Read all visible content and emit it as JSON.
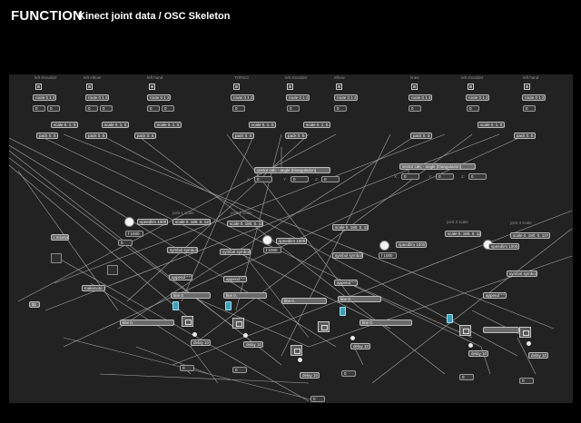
{
  "header": {
    "title": "FUNCTION",
    "subtitle": "Kinect joint data / OSC Skeleton"
  },
  "patch": {
    "joint_labels": [
      "left shoulder",
      "left elbow",
      "left hand",
      "TORSO",
      "left shoulder",
      "elbow",
      "knee",
      "left shoulder",
      "left hand"
    ],
    "route_labels": [
      "route 0 1 2 3",
      "route 0 1 2 3",
      "route 0 1 2 3",
      "route 0 1 2 3",
      "route 0 1 2 3",
      "route 0 1 2 3",
      "route 0 1 2 3",
      "route 0 1 2 3",
      "route 0 1 2 3"
    ],
    "scale_labels": [
      "scale 0. 1. 0. 1.",
      "scale 0. 1. 0. 1.",
      "scale 0. 1. 0. 1.",
      "scale 0. 1. 0. 1.",
      "scale 0. 1. 0. 1.",
      "scale 0. 1. 0. 1."
    ],
    "pack_labels": [
      "pack 0. 0. 0.",
      "pack 0. 0. 0.",
      "pack 0. 0. 0.",
      "pack 0. 0. 0.",
      "pack 0. 0. 0.",
      "pack 0. 0. 0.",
      "pack 0. 0. 0."
    ],
    "vector_left": "vector calc - angle (triangulation)",
    "vector_right": "vector calc - angle (triangulation)",
    "axis_x": "X:",
    "axis_y": "Y:",
    "axis_z": "Z:",
    "joint_scale_1": "joint 1 scale",
    "joint_scale_2": "joint 2 scale",
    "joint_scale_3": "joint 3 scale",
    "joint_scale_4": "joint 4 scale",
    "scale_obj_1": "scale 0. 180. 0. 127.",
    "scale_obj_2": "scale 0. 180. 0. 127.",
    "scale_obj_3": "scale 0. 180. 0. 127.",
    "scale_obj_4": "scale 0. 180. 0. 127.",
    "scale_obj_5": "scale 0. 180. 0. 127.",
    "scale_obj_6": "scale 0. 180. 0. 127.",
    "metro_1": "metro 1000",
    "metro_2": "metro 1000",
    "metro_3": "metro 1000",
    "speedlim_1": "speedlim 1000",
    "speedlim_2": "speedlim 1000",
    "speedlim_3": "speedlim 1000",
    "speedlim_4": "speedlim 1000",
    "symbol_1": "symbol symbol 52",
    "symbol_2": "symbol symbol 52",
    "symbol_3": "symbol symbol 52",
    "symbol_4": "symbol symbol 52",
    "append_1": "append \" \"",
    "append_2": "append \" \"",
    "append_3": "append \" \"",
    "append_4": "append \" \"",
    "receive": "r receive",
    "makenote": "makenote 100",
    "msg_1": "$1",
    "numbers": [
      "0",
      "0",
      "0",
      "0",
      "0",
      "0",
      "0",
      "0",
      "0",
      "0",
      "0",
      "0",
      "0",
      "0",
      "0",
      "0",
      "0",
      "0",
      "0"
    ],
    "delays": [
      "delay 10",
      "delay 10",
      "delay 10",
      "delay 10",
      "delay 10"
    ],
    "floats": [
      "f 1000",
      "f 1000",
      "f 1000"
    ],
    "lines": [
      "line 0.",
      "line 0.",
      "line 0.",
      "line 0.",
      "line 0.",
      "line 0."
    ]
  },
  "colors": {
    "background": "#000000",
    "canvas": "#222222",
    "object": "#4c4c4c",
    "cable": "#b8b8b8",
    "function_object": "#3fa0b8"
  },
  "icons": {
    "toggle": "toggle-icon",
    "bang": "bang-icon",
    "function_graph": "function-graph-icon"
  }
}
